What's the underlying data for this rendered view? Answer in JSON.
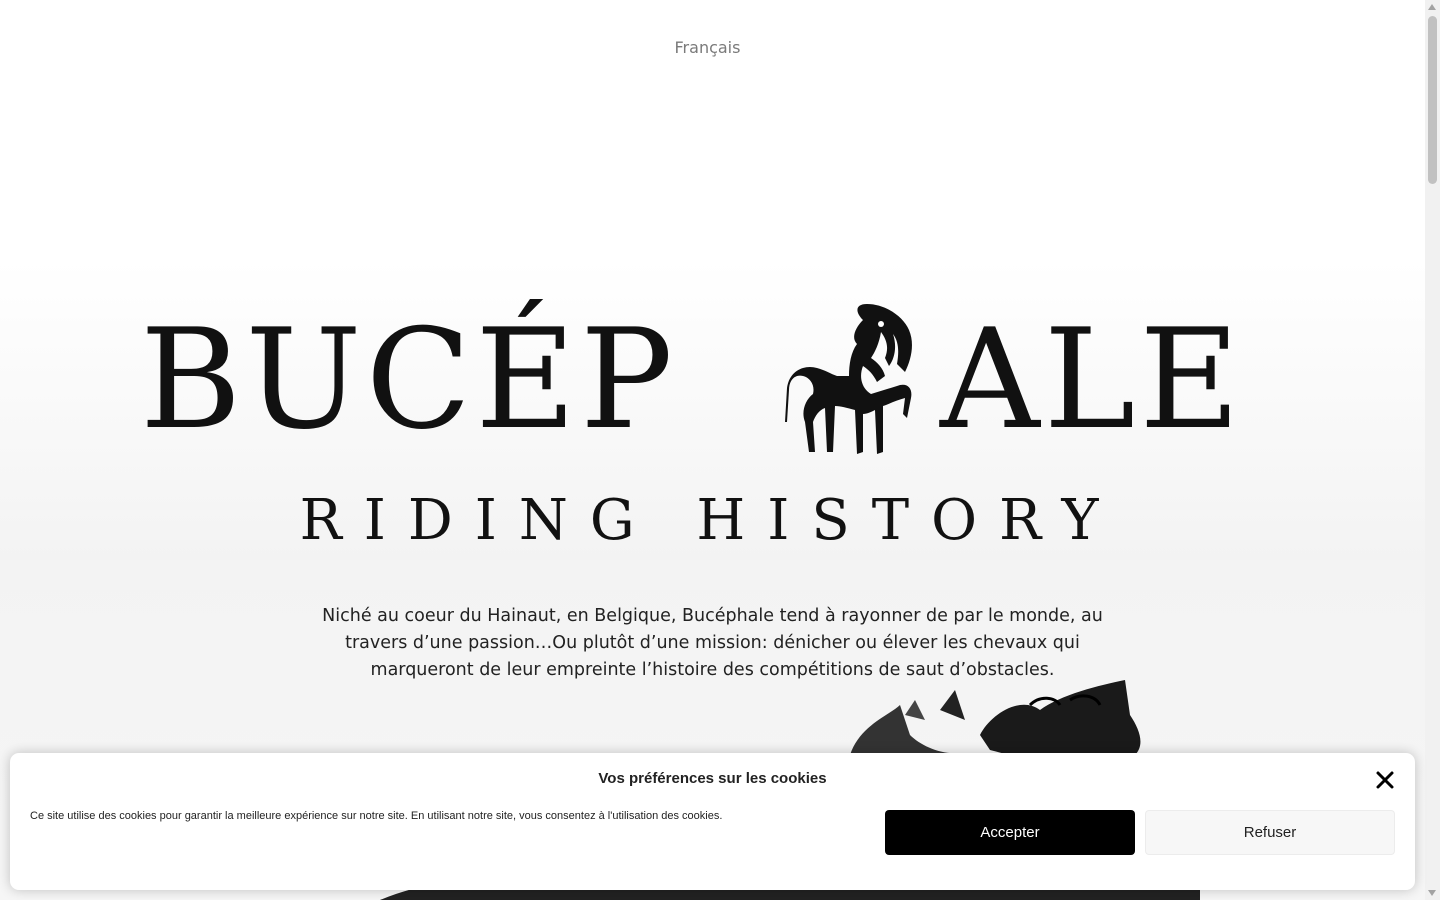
{
  "language_switch": {
    "label": "Français"
  },
  "logo": {
    "word_left": "BUCÉP",
    "word_right": "ALE",
    "tagline": "RIDING HISTORY"
  },
  "intro": {
    "text": "Niché au coeur du Hainaut, en Belgique, Bucéphale tend à rayonner de par le monde, au travers d’une passion…Ou plutôt d’une mission: dénicher ou élever les chevaux qui marqueront de leur empreinte l’histoire des compétitions de saut d’obstacles."
  },
  "cookie_banner": {
    "title": "Vos préférences sur les cookies",
    "text": "Ce site utilise des cookies pour garantir la meilleure expérience sur notre site. En utilisant notre site, vous consentez à l'utilisation des cookies.",
    "accept_label": "Accepter",
    "refuse_label": "Refuser",
    "close_icon": "close-icon"
  },
  "colors": {
    "text_dark": "#111111",
    "muted_text": "#7a7a7a",
    "accept_bg": "#000000",
    "refuse_bg": "#f7f7f7"
  }
}
